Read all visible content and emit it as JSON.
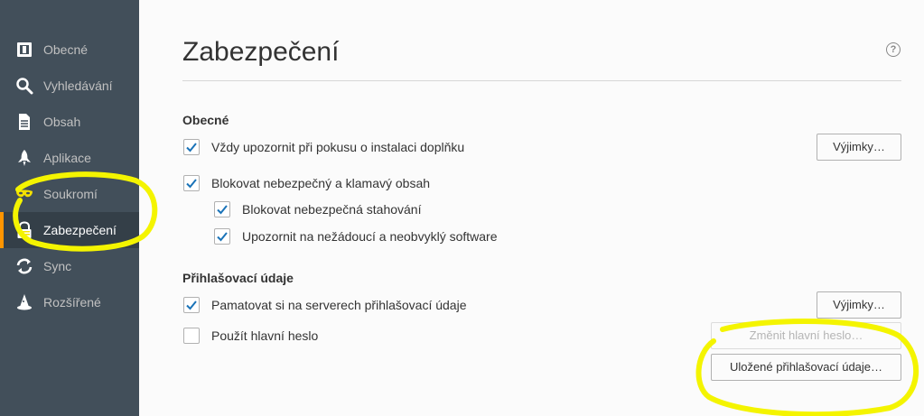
{
  "sidebar": {
    "items": [
      {
        "label": "Obecné",
        "icon": "general-icon"
      },
      {
        "label": "Vyhledávání",
        "icon": "search-icon"
      },
      {
        "label": "Obsah",
        "icon": "document-icon"
      },
      {
        "label": "Aplikace",
        "icon": "rocket-icon"
      },
      {
        "label": "Soukromí",
        "icon": "mask-icon"
      },
      {
        "label": "Zabezpečení",
        "icon": "lock-icon"
      },
      {
        "label": "Sync",
        "icon": "sync-icon"
      },
      {
        "label": "Rozšířené",
        "icon": "wizard-hat-icon"
      }
    ],
    "active_index": 5
  },
  "main": {
    "title": "Zabezpečení",
    "help": "?",
    "sections": {
      "general": {
        "title": "Obecné",
        "warn_addons": "Vždy upozornit při pokusu o instalaci doplňku",
        "block_dangerous": "Blokovat nebezpečný a klamavý obsah",
        "block_downloads": "Blokovat nebezpečná stahování",
        "warn_unwanted": "Upozornit na nežádoucí a neobvyklý software",
        "exceptions_button": "Výjimky…"
      },
      "logins": {
        "title": "Přihlašovací údaje",
        "remember_logins": "Pamatovat si na serverech přihlašovací údaje",
        "use_master_password": "Použít hlavní heslo",
        "exceptions_button": "Výjimky…",
        "change_master_button": "Změnit hlavní heslo…",
        "saved_logins_button": "Uložené přihlašovací údaje…"
      }
    }
  },
  "colors": {
    "sidebar_bg": "#424f5a",
    "active_accent": "#ff9500",
    "checkbox_check": "#1a73b8",
    "highlight": "#f4f400"
  }
}
